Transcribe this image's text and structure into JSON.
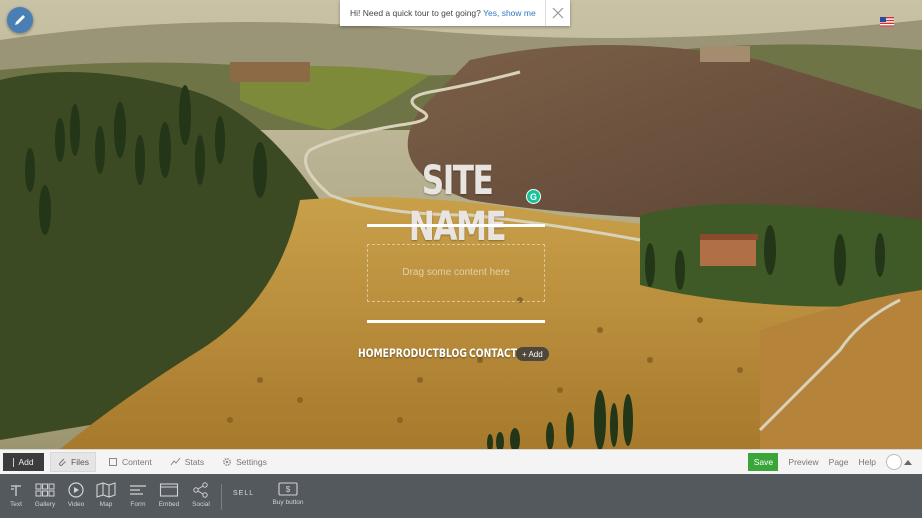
{
  "tour_banner": {
    "question": "Hi! Need a quick tour to get going?",
    "link": "Yes, show me"
  },
  "hero": {
    "site_name": "SITE NAME",
    "drop_placeholder": "Drag some content here",
    "nav": [
      "HOME",
      "PRODUCTS",
      "BLOG",
      "CONTACT"
    ],
    "add_label": "+ Add"
  },
  "toolbar": {
    "add_label": "Add",
    "tabs": [
      "Files",
      "Content",
      "Stats",
      "Settings"
    ],
    "active_tab": "Files",
    "save_label": "Save",
    "preview_label": "Preview",
    "page_label": "Page",
    "help_label": "Help"
  },
  "tray": {
    "tools": [
      "Text",
      "Gallery",
      "Video",
      "Map",
      "Form",
      "Embed",
      "Social"
    ],
    "sell_label": "SELL",
    "buy_button_label": "Buy button"
  },
  "colors": {
    "save_green": "#3aa63a",
    "tray_bg": "#54595d",
    "link_blue": "#2f78c4",
    "pencil_blue": "#4a7fb6"
  }
}
